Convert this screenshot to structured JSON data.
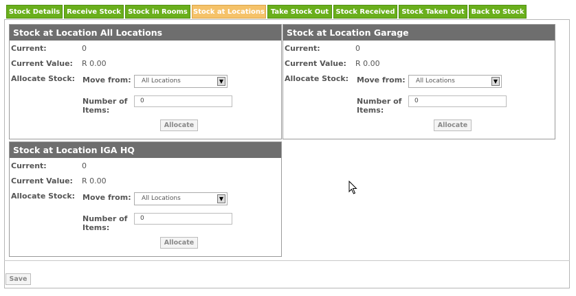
{
  "tabs": [
    {
      "label": "Stock Details",
      "active": false
    },
    {
      "label": "Receive Stock",
      "active": false
    },
    {
      "label": "Stock in Rooms",
      "active": false
    },
    {
      "label": "Stock at Locations",
      "active": true
    },
    {
      "label": "Take Stock Out",
      "active": false
    },
    {
      "label": "Stock Received",
      "active": false
    },
    {
      "label": "Stock Taken Out",
      "active": false
    },
    {
      "label": "Back to Stock",
      "active": false
    }
  ],
  "labels": {
    "current": "Current:",
    "current_value": "Current Value:",
    "allocate_stock": "Allocate Stock:",
    "move_from": "Move from:",
    "number_of": "Number of",
    "items": "Items:",
    "allocate_button": "Allocate"
  },
  "panels": [
    {
      "title": "Stock at Location All Locations",
      "current": "0",
      "current_value": "R 0.00",
      "move_from": "All Locations",
      "number_of_items": "0"
    },
    {
      "title": "Stock at Location Garage",
      "current": "0",
      "current_value": "R 0.00",
      "move_from": "All Locations",
      "number_of_items": "0"
    },
    {
      "title": "Stock at Location IGA HQ",
      "current": "0",
      "current_value": "R 0.00",
      "move_from": "All Locations",
      "number_of_items": "0"
    }
  ],
  "footer": {
    "save_label": "Save"
  },
  "colors": {
    "tab_bg": "#6aaf1c",
    "tab_active_bg": "#f5c269",
    "panel_header_bg": "#6e6e6e"
  }
}
